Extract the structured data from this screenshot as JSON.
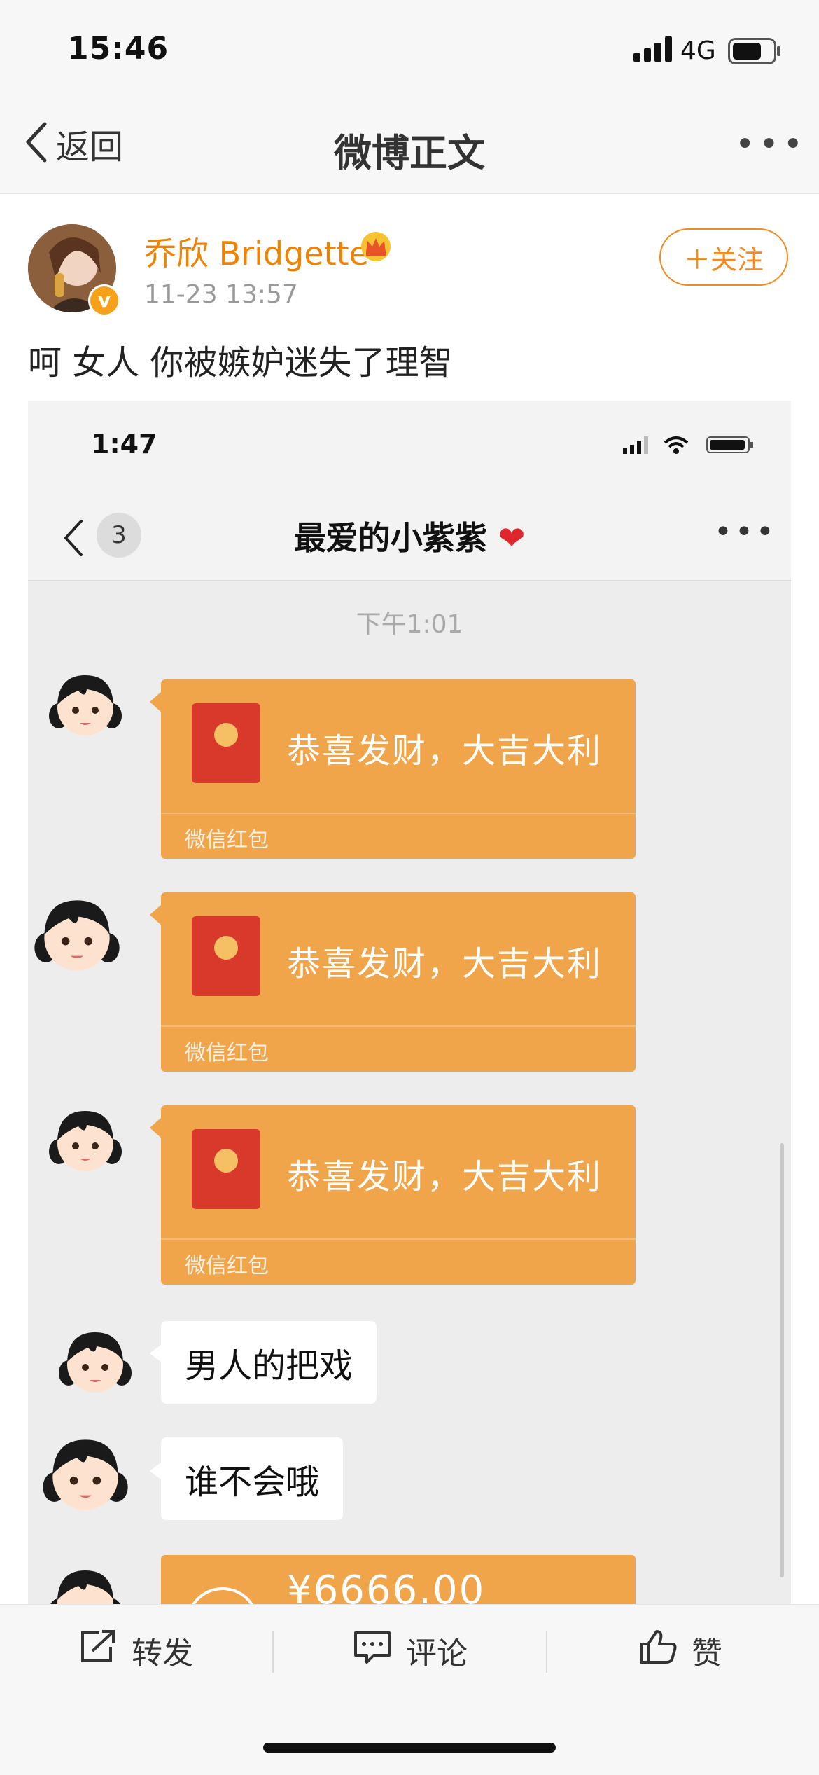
{
  "status_bar": {
    "time": "15:46",
    "network": "4G"
  },
  "nav": {
    "back_label": "返回",
    "title": "微博正文",
    "more": "•••"
  },
  "post": {
    "author": "乔欣 Bridgette",
    "time": "11-23 13:57",
    "follow_label": "＋关注",
    "text": "呵 女人 你被嫉妒迷失了理智"
  },
  "screenshot": {
    "status_time": "1:47",
    "unread_count": "3",
    "chat_title": "最爱的小紫紫",
    "chat_heart": "❤",
    "more": "•••",
    "timestamp": "下午1:01",
    "messages": [
      {
        "type": "red_packet",
        "text": "恭喜发财，大吉大利",
        "label": "微信红包"
      },
      {
        "type": "red_packet",
        "text": "恭喜发财，大吉大利",
        "label": "微信红包"
      },
      {
        "type": "red_packet",
        "text": "恭喜发财，大吉大利",
        "label": "微信红包"
      },
      {
        "type": "text",
        "text": "男人的把戏"
      },
      {
        "type": "text",
        "text": "谁不会哦"
      },
      {
        "type": "transfer",
        "text": "¥6666.00"
      }
    ]
  },
  "actions": {
    "repost": "转发",
    "comment": "评论",
    "like": "赞"
  },
  "colors": {
    "accent": "#f58b1f",
    "red_packet": "#f0a54a",
    "packet_icon": "#d8392a"
  }
}
